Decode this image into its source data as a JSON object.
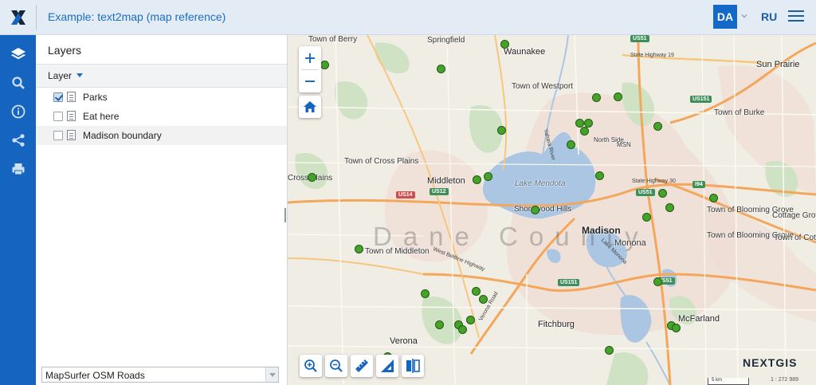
{
  "header": {
    "title": "Example: text2map (map reference)",
    "lang_active": "DA",
    "lang_other": "RU"
  },
  "rail": {
    "items": [
      "layers-icon",
      "search-icon",
      "info-icon",
      "share-icon",
      "print-icon"
    ],
    "active": "layers-icon"
  },
  "panel": {
    "title": "Layers",
    "column_header": "Layer",
    "layers": [
      {
        "name": "Parks",
        "checked": true
      },
      {
        "name": "Eat here",
        "checked": false
      },
      {
        "name": "Madison boundary",
        "checked": false
      }
    ],
    "basemap": "MapSurfer OSM Roads"
  },
  "map": {
    "places": [
      "Town of Berry",
      "Springfield",
      "Waunakee",
      "Town of Westport",
      "Sun Prairie",
      "Town of Burke",
      "North Side",
      "MSN",
      "Town of Cross Plains",
      "Cross Plains",
      "Middleton",
      "Lake Mendota",
      "Shorewood Hills",
      "Madison",
      "Monona",
      "Town of Middleton",
      "Town of Blooming Grove",
      "Cottage Grove",
      "Town of Cottage Grove",
      "Verona",
      "Fitchburg",
      "McFarland",
      "Dane County"
    ],
    "roads": [
      "US51",
      "State Highway 19",
      "US151",
      "State Highway 30",
      "US12",
      "US14",
      "I94",
      "West Beltline Highway",
      "Verona Road",
      "Yahara River",
      "Lake Monona"
    ],
    "scale_text": "5 km",
    "scale_ratio": "1 : 272 989",
    "brand": "NEXTGIS",
    "brand_x": "X"
  },
  "colors": {
    "accent": "#1565c0",
    "park_marker": "#46a329",
    "water": "#aac6e3"
  }
}
